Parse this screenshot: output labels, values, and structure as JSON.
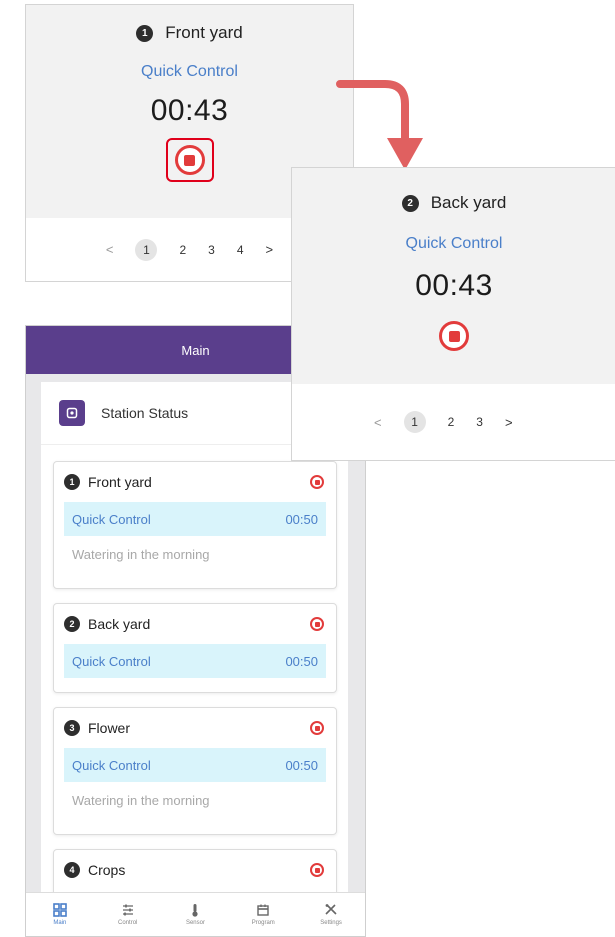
{
  "front_card": {
    "number": "1",
    "title": "Front yard",
    "mode": "Quick Control",
    "timer": "00:43",
    "pagination": {
      "prev": "<",
      "pages": [
        "1",
        "2",
        "3",
        "4"
      ],
      "active": "1",
      "next": ">"
    }
  },
  "back_card": {
    "number": "2",
    "title": "Back yard",
    "mode": "Quick Control",
    "timer": "00:43",
    "pagination": {
      "prev": "<",
      "pages": [
        "1",
        "2",
        "3"
      ],
      "active": "1",
      "next": ">"
    }
  },
  "colors": {
    "header_purple": "#5a3e8c",
    "stop_red": "#e23b3b",
    "highlight_frame": "#e0001b",
    "arrow": "#e06060",
    "link_blue": "#4a7fc9",
    "quick_row_bg": "#d9f4fb"
  },
  "app": {
    "header_title": "Main",
    "header_icons": [
      "add-widget-icon",
      "globe-icon"
    ],
    "section_icon": "station-status-icon",
    "section_title": "Station Status",
    "stations": [
      {
        "number": "1",
        "name": "Front yard",
        "mode": "Quick Control",
        "time": "00:50",
        "note": "Watering in the morning"
      },
      {
        "number": "2",
        "name": "Back yard",
        "mode": "Quick Control",
        "time": "00:50"
      },
      {
        "number": "3",
        "name": "Flower",
        "mode": "Quick Control",
        "time": "00:50",
        "note": "Watering in the morning"
      },
      {
        "number": "4",
        "name": "Crops"
      }
    ],
    "nav": [
      {
        "label": "Main",
        "icon": "grid-icon",
        "active": true
      },
      {
        "label": "Control",
        "icon": "sliders-icon"
      },
      {
        "label": "Sensor",
        "icon": "thermometer-icon"
      },
      {
        "label": "Program",
        "icon": "calendar-icon"
      },
      {
        "label": "Settings",
        "icon": "tools-icon"
      }
    ]
  }
}
